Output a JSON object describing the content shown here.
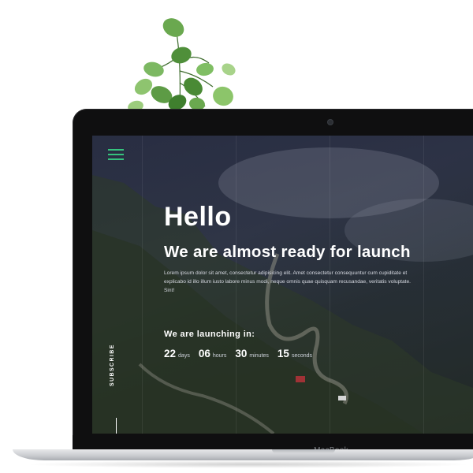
{
  "screen": {
    "heading": "Hello",
    "headline": "We are almost ready for launch",
    "description": "Lorem ipsum dolor sit amet, consectetur adipisicing elit. Amet consectetur consequuntur cum cupiditate et explicabo id illo illum iusto labore minus modi, neque omnis quae quisquam recusandae, veritatis voluptate. Sint!",
    "launch_label": "We are launching in:",
    "countdown": [
      {
        "value": "22",
        "unit": "days"
      },
      {
        "value": "06",
        "unit": "hours"
      },
      {
        "value": "30",
        "unit": "minutes"
      },
      {
        "value": "15",
        "unit": "seconds"
      }
    ],
    "subscribe_label": "SUBSCRIBE",
    "menu_icon": "hamburger-menu-icon"
  },
  "device": {
    "brand": "MacBook"
  },
  "colors": {
    "accent": "#35c37d",
    "overlay": "#21263a",
    "text": "#ffffff"
  }
}
